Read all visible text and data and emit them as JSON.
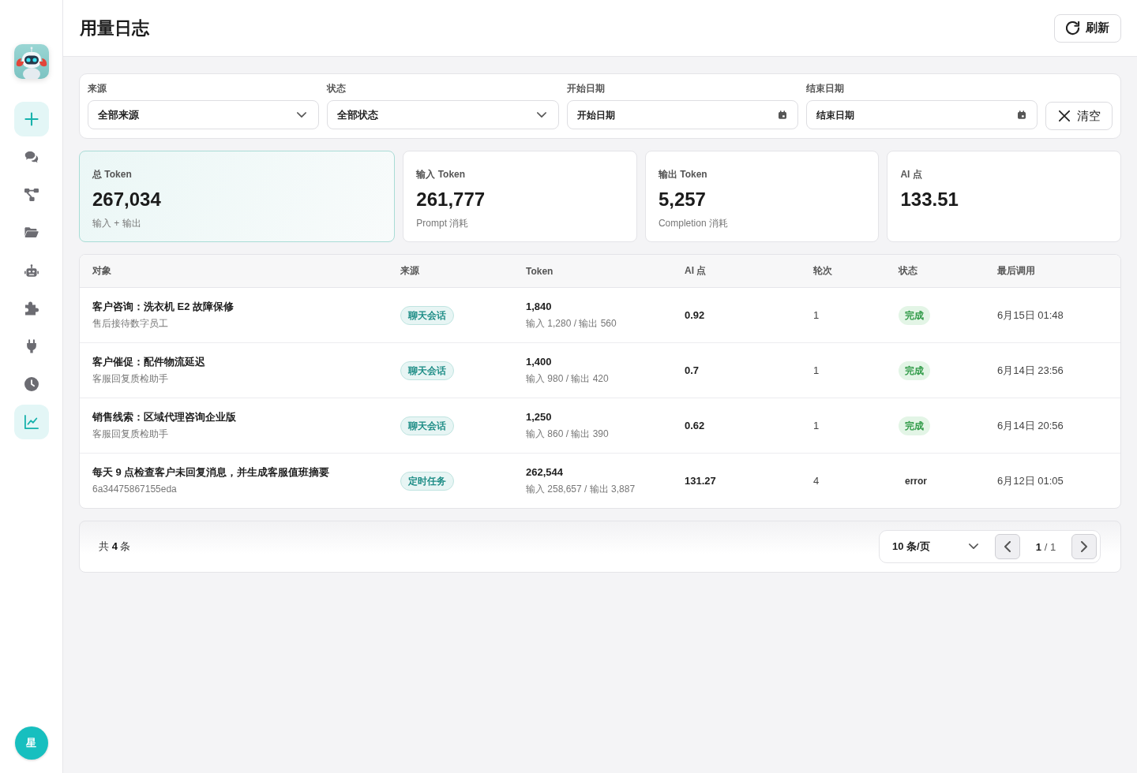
{
  "sidebar": {
    "items": [
      {
        "kind": "add",
        "selected": false
      },
      {
        "kind": "chat",
        "selected": false
      },
      {
        "kind": "flow",
        "selected": false
      },
      {
        "kind": "folder",
        "selected": false
      },
      {
        "kind": "robot",
        "selected": false
      },
      {
        "kind": "plugin",
        "selected": false
      },
      {
        "kind": "plug",
        "selected": false
      },
      {
        "kind": "history",
        "selected": false
      },
      {
        "kind": "usage",
        "selected": true
      }
    ],
    "avatar": {
      "initial": "星"
    }
  },
  "header": {
    "title": "用量日志",
    "refresh_button": "刷新"
  },
  "filters": {
    "fields": [
      {
        "kind": "select",
        "label": "来源",
        "value": "全部来源"
      },
      {
        "kind": "select",
        "label": "状态",
        "value": "全部状态"
      },
      {
        "kind": "date",
        "label": "开始日期",
        "placeholder": "开始日期"
      },
      {
        "kind": "date",
        "label": "结束日期",
        "placeholder": "结束日期"
      }
    ],
    "clear_button": "清空"
  },
  "stats": [
    {
      "label": "总 Token",
      "value": "267,034",
      "note": "输入 + 输出",
      "highlighted": true
    },
    {
      "label": "输入 Token",
      "value": "261,777",
      "note": "Prompt 消耗",
      "highlighted": false
    },
    {
      "label": "输出 Token",
      "value": "5,257",
      "note": "Completion 消耗",
      "highlighted": false
    },
    {
      "label": "AI 点",
      "value": "133.51",
      "highlighted": false
    }
  ],
  "table": {
    "columns": [
      "对象",
      "来源",
      "Token",
      "AI 点",
      "轮次",
      "状态",
      "最后调用"
    ],
    "rows": [
      {
        "title": "客户咨询：洗衣机 E2 故障保修",
        "subtitle": "售后接待数字员工",
        "source": "聊天会话",
        "tokens": "1,840",
        "token_detail": "输入 1,280 / 输出 560",
        "ai_points": "0.92",
        "rounds": "1",
        "status": {
          "kind": "success",
          "label": "完成"
        },
        "last_called": "6月15日 01:48"
      },
      {
        "title": "客户催促：配件物流延迟",
        "subtitle": "客服回复质检助手",
        "source": "聊天会话",
        "tokens": "1,400",
        "token_detail": "输入 980 / 输出 420",
        "ai_points": "0.7",
        "rounds": "1",
        "status": {
          "kind": "success",
          "label": "完成"
        },
        "last_called": "6月14日 23:56"
      },
      {
        "title": "销售线索：区域代理咨询企业版",
        "subtitle": "客服回复质检助手",
        "source": "聊天会话",
        "tokens": "1,250",
        "token_detail": "输入 860 / 输出 390",
        "ai_points": "0.62",
        "rounds": "1",
        "status": {
          "kind": "success",
          "label": "完成"
        },
        "last_called": "6月14日 20:56"
      },
      {
        "title": "每天 9 点检查客户未回复消息，并生成客服值班摘要",
        "subtitle": "6a34475867155eda",
        "source": "定时任务",
        "tokens": "262,544",
        "token_detail": "输入 258,657 / 输出 3,887",
        "ai_points": "131.27",
        "rounds": "4",
        "status": {
          "kind": "error",
          "label": "error"
        },
        "last_called": "6月12日 01:05"
      }
    ]
  },
  "pagination": {
    "total": "共 **4** 条",
    "page_size": "10 条/页",
    "page": "**1** / 1"
  }
}
